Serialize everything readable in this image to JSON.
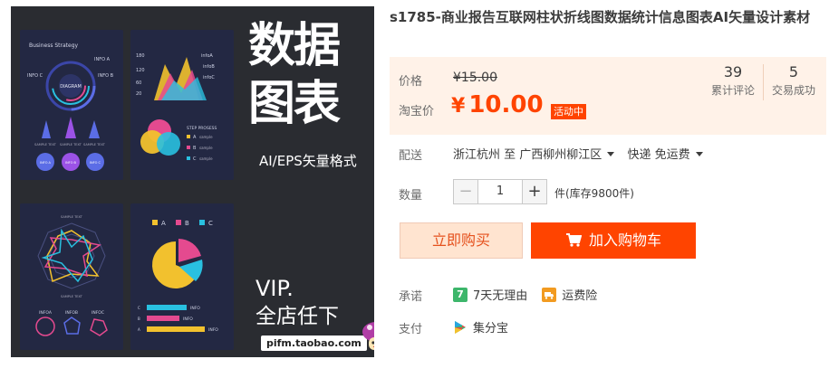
{
  "image": {
    "big_title_line1": "数据",
    "big_title_line2": "图表",
    "format_text": "AI/EPS矢量格式",
    "vip_line1": "VIP.",
    "vip_line2": "全店任下",
    "store_url": "pifm.taobao.com",
    "mock_business_title": "Business Strategy",
    "mock_diagram_label": "DIAGRAM",
    "mock_info_a": "INFO A",
    "mock_info_b": "INFO B",
    "mock_info_c": "INFO C",
    "mock_infoA": "infoA",
    "mock_infoB": "infoB",
    "mock_infoC": "infoC",
    "mock_sample_text": "SAMPLE TEXT",
    "mock_step_process": "STEP PROSESS",
    "mock_info": "INFO",
    "mock_y_ticks": [
      "180",
      "120",
      "60",
      "20"
    ],
    "mock_legend_a": "A",
    "mock_legend_b": "B",
    "mock_legend_c": "C",
    "mock_sample": "sample",
    "mock_infoA_upper": "INFOA",
    "mock_infoB_upper": "INFOB",
    "mock_infoC_upper": "INFOC",
    "mock_info_small": "INFO",
    "mock_bar_cats": [
      "C",
      "B",
      "A"
    ]
  },
  "product": {
    "title": "s1785-商业报告互联网柱状折线图数据统计信息图表AI矢量设计素材",
    "price_label": "价格",
    "original_price": "¥15.00",
    "promo_label": "淘宝价",
    "promo_currency": "¥",
    "promo_price": "10.00",
    "promo_tag": "活动中",
    "reviews_count": "39",
    "reviews_label": "累计评论",
    "sales_count": "5",
    "sales_label": "交易成功"
  },
  "shipping": {
    "label": "配送",
    "from": "浙江杭州 至",
    "to": "广西柳州柳江区",
    "method": "快递 免运费"
  },
  "quantity": {
    "label": "数量",
    "minus": "−",
    "value": "1",
    "plus": "+",
    "stock": "件(库存9800件)"
  },
  "buttons": {
    "buy_now": "立即购买",
    "add_to_cart": "加入购物车"
  },
  "promise": {
    "label": "承诺",
    "return_policy": "7天无理由",
    "return_badge": "7",
    "freight_insurance": "运费险"
  },
  "payment": {
    "label": "支付",
    "method": "集分宝"
  },
  "colors": {
    "accent": "#ff4400",
    "price_bg": "#fff2e8",
    "buy_now_bg": "#ffe4d0",
    "badge_green": "#3db66b",
    "badge_orange": "#f29b21"
  }
}
